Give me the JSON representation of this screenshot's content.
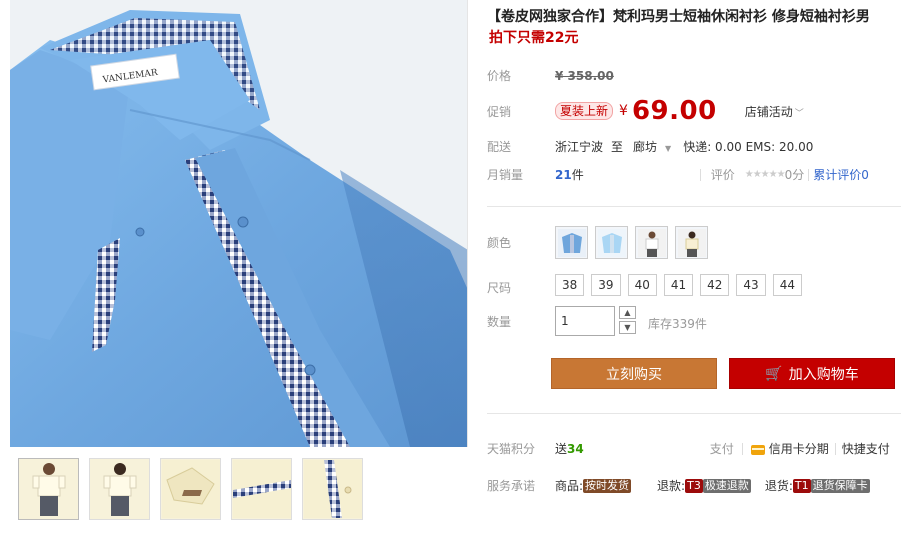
{
  "gallery": {
    "brand_label": "VANLEMAR",
    "thumbnails": [
      {
        "name": "thumb-front-model"
      },
      {
        "name": "thumb-back-model"
      },
      {
        "name": "thumb-collar-detail"
      },
      {
        "name": "thumb-placket-detail"
      },
      {
        "name": "thumb-button-detail"
      }
    ]
  },
  "product": {
    "title": "【卷皮网独家合作】梵利玛男士短袖休闲衬衫 修身短袖衬衫男",
    "promo": "拍下只需22元"
  },
  "price": {
    "label": "价格",
    "original": "¥ 358.00",
    "promo_label": "促销",
    "badge": "夏装上新",
    "yen": "¥",
    "current": "69.00",
    "shop_activity": "店铺活动"
  },
  "shipping": {
    "label": "配送",
    "from": "浙江宁波",
    "to_word": "至",
    "to": "廊坊",
    "fees": "快递: 0.00 EMS: 20.00"
  },
  "sales": {
    "label": "月销量",
    "count": "21",
    "unit": "件",
    "review_label": "评价",
    "stars": "★★★★★",
    "score": "0分",
    "review_total": "累计评价0",
    "rating_stars": 0
  },
  "color": {
    "label": "颜色",
    "options": [
      "blue-shirt",
      "lightblue-shirt",
      "white-model",
      "beige-model"
    ]
  },
  "size": {
    "label": "尺码",
    "options": [
      "38",
      "39",
      "40",
      "41",
      "42",
      "43",
      "44"
    ]
  },
  "quantity": {
    "label": "数量",
    "value": "1",
    "up": "▲",
    "down": "▼",
    "stock": "库存339件"
  },
  "actions": {
    "buy_now": "立刻购买",
    "add_cart": "加入购物车",
    "cart_icon": "🛒"
  },
  "points": {
    "label": "天猫积分",
    "send": "送",
    "value": "34",
    "pay_label": "支付",
    "credit": "信用卡分期",
    "quick": "快捷支付"
  },
  "service": {
    "label": "服务承诺",
    "goods_label": "商品:",
    "goods_tag": "按时发货",
    "refund_label": "退款:",
    "refund_t": "T3",
    "refund_tag": "极速退款",
    "return_label": "退货:",
    "return_t": "T1",
    "return_tag": "退货保障卡"
  },
  "colors": {
    "accent_red": "#c40000",
    "buy_orange": "#c87734",
    "shirt_blue": "#7bb2e6"
  }
}
